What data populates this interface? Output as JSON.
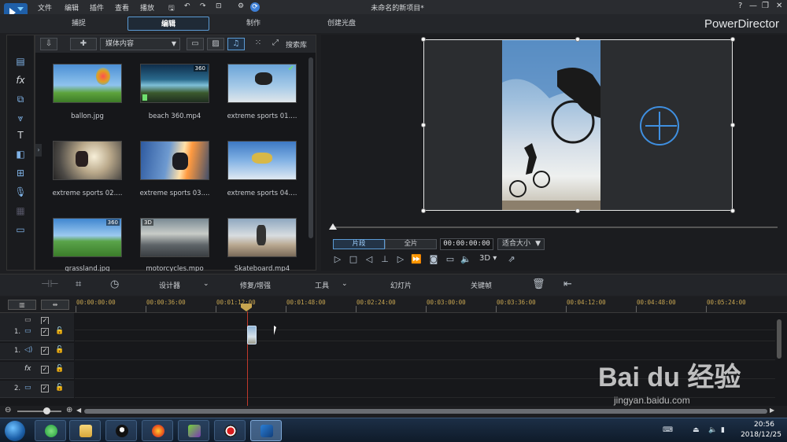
{
  "menu": [
    "文件",
    "编辑",
    "插件",
    "查看",
    "播放"
  ],
  "title_bar": {
    "zoom": "⊡",
    "title": "未命名的新项目*",
    "help": "?",
    "minimize": "—",
    "restore": "❐",
    "close": "✕"
  },
  "modes": {
    "capture": "捕捉",
    "edit": "编辑",
    "produce": "制作",
    "disc": "创建光盘"
  },
  "brand": "PowerDirector",
  "library": {
    "dropdown": "媒体内容",
    "search": "搜索库",
    "items": [
      {
        "label": "ballon.jpg",
        "badge": "",
        "badge_left": ""
      },
      {
        "label": "beach 360.mp4",
        "badge": "360",
        "badge_left": ""
      },
      {
        "label": "extreme sports 01....",
        "badge": "",
        "badge_left": ""
      },
      {
        "label": "extreme sports 02....",
        "badge": "",
        "badge_left": ""
      },
      {
        "label": "extreme sports 03....",
        "badge": "",
        "badge_left": ""
      },
      {
        "label": "extreme sports 04....",
        "badge": "",
        "badge_left": ""
      },
      {
        "label": "grassland.jpg",
        "badge": "360",
        "badge_left": ""
      },
      {
        "label": "motorcycles.mpo",
        "badge": "",
        "badge_left": "3D"
      },
      {
        "label": "Skateboard.mp4",
        "badge": "",
        "badge_left": ""
      }
    ],
    "check": "✔"
  },
  "preview": {
    "clip_tab": "片段",
    "full_tab": "全片",
    "timecode": "00:00:00:00",
    "fit": "适合大小",
    "three_d": "3D"
  },
  "edit_toolbar": {
    "designer": "设计器",
    "fix": "修复/增强",
    "tools": "工具",
    "slideshow": "幻灯片",
    "keyframe": "关键帧"
  },
  "timeline": {
    "ruler": [
      "00:00:00:00",
      "00:00:36:00",
      "00:01:12:00",
      "00:01:48:00",
      "00:02:24:00",
      "00:03:00:00",
      "00:03:36:00",
      "00:04:12:00",
      "00:04:48:00",
      "00:05:24:00"
    ],
    "tracks": [
      {
        "num": "",
        "type": "master"
      },
      {
        "num": "1.",
        "type": "video"
      },
      {
        "num": "1.",
        "type": "audio"
      },
      {
        "num": "",
        "type": "fx"
      },
      {
        "num": "2.",
        "type": "video"
      }
    ]
  },
  "taskbar": {
    "time": "20:56",
    "date": "2018/12/25"
  },
  "watermark": {
    "main": "Bai du 经验",
    "url": "jingyan.baidu.com"
  }
}
